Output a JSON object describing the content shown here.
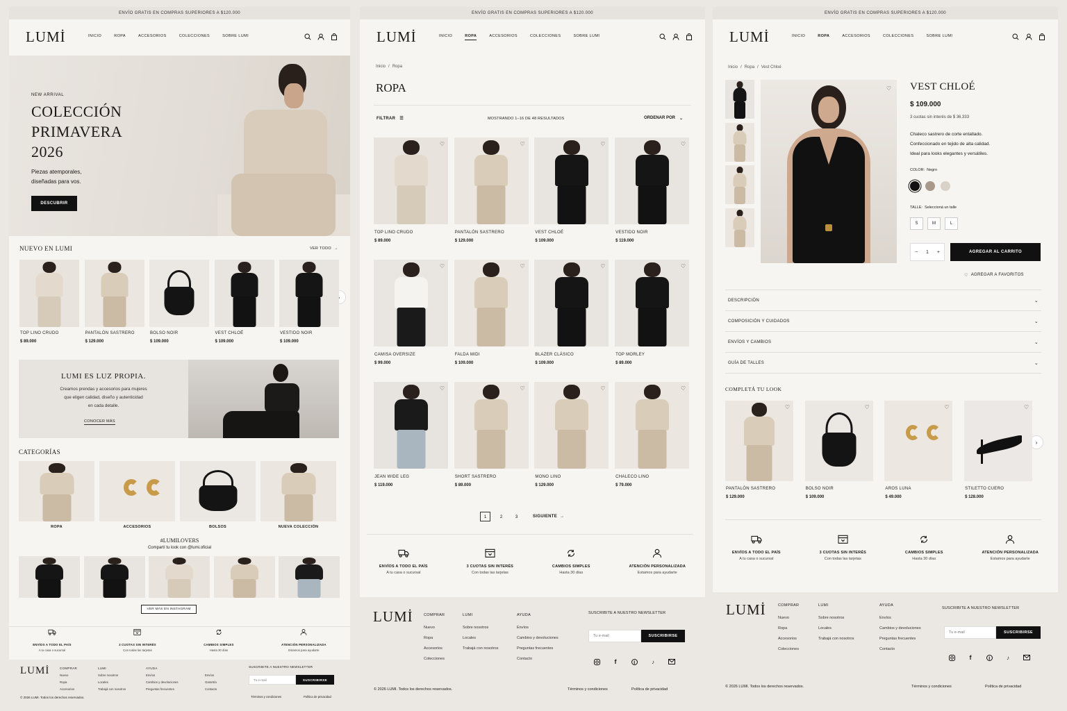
{
  "promo": "ENVÍO GRATIS EN COMPRAS SUPERIORES A $120.000",
  "brand": "LUMİ",
  "nav": [
    "INICIO",
    "ROPA",
    "ACCESORIOS",
    "COLECCIONES",
    "SOBRE LUMI"
  ],
  "home": {
    "hero": {
      "eyebrow": "NEW ARRIVAL",
      "title1": "COLECCIÓN",
      "title2": "PRIMAVERA",
      "title3": "2026",
      "sub1": "Piezas atemporales,",
      "sub2": "diseñadas para vos.",
      "cta": "DESCUBRIR"
    },
    "new_title": "NUEVO EN LUMI",
    "see_all": "VER TODO",
    "new_items": [
      {
        "name": "TOP LINO CRUDO",
        "price": "$ 89.000"
      },
      {
        "name": "PANTALÓN SASTRERO",
        "price": "$ 129.000"
      },
      {
        "name": "BOLSO NOIR",
        "price": "$ 109.000"
      },
      {
        "name": "VEST CHLOÉ",
        "price": "$ 109.000"
      },
      {
        "name": "VESTIDO NOIR",
        "price": "$ 109.000"
      }
    ],
    "banner": {
      "title": "LUMI ES LUZ PROPIA.",
      "l1": "Creamos prendas y accesorios para mujeres",
      "l2": "que eligen calidad, diseño y autenticidad",
      "l3": "en cada detalle.",
      "link": "CONOCER MÁS"
    },
    "cat_title": "CATEGORÍAS",
    "categories": [
      "ROPA",
      "ACCESORIOS",
      "BOLSOS",
      "NUEVA COLECCIÓN"
    ],
    "insta_tag": "#LUMILOVERS",
    "insta_sub": "Compartí tu look con @lumi.oficial",
    "insta_btn": "VER MÁS EN INSTAGRAM",
    "footer_extra": [
      "Envíos",
      "Garantía",
      "Contacto"
    ]
  },
  "benefits": [
    {
      "t": "ENVÍOS A TODO EL PAÍS",
      "s": "A tu casa o sucursal"
    },
    {
      "t": "3 CUOTAS SIN INTERÉS",
      "s": "Con todas las tarjetas"
    },
    {
      "t": "CAMBIOS SIMPLES",
      "s": "Hasta 30 días"
    },
    {
      "t": "ATENCIÓN PERSONALIZADA",
      "s": "Estamos para ayudarte"
    }
  ],
  "footer": {
    "cols": [
      {
        "h": "COMPRAR",
        "items": [
          "Nuevo",
          "Ropa",
          "Accesorios",
          "Colecciones"
        ]
      },
      {
        "h": "LUMI",
        "items": [
          "Sobre nosotros",
          "Locales",
          "Trabajá con nosotros"
        ]
      },
      {
        "h": "AYUDA",
        "items": [
          "Envíos",
          "Cambios y devoluciones",
          "Preguntas frecuentes",
          "Contacto"
        ]
      }
    ],
    "news_title": "SUSCRIBITE A NUESTRO NEWSLETTER",
    "email_ph": "Tu e-mail",
    "subscribe": "SUSCRIBIRSE",
    "copyright": "© 2026 LUMI. Todos los derechos reservados.",
    "terms": "Términos y condiciones",
    "privacy": "Política de privacidad"
  },
  "listing": {
    "crumb_home": "Inicio",
    "crumb_sep": "/",
    "crumb_cur": "Ropa",
    "title": "ROPA",
    "filter": "FILTRAR",
    "results": "MOSTRANDO 1–16 DE 48 RESULTADOS",
    "sort": "ORDENAR POR",
    "products": [
      {
        "name": "TOP LINO CRUDO",
        "price": "$ 89.000"
      },
      {
        "name": "PANTALÓN SASTRERO",
        "price": "$ 129.000"
      },
      {
        "name": "VEST CHLOÉ",
        "price": "$ 109.000"
      },
      {
        "name": "VESTIDO NOIR",
        "price": "$ 119.000"
      },
      {
        "name": "CAMISA OVERSIZE",
        "price": "$ 99.000"
      },
      {
        "name": "FALDA MIDI",
        "price": "$ 109.000"
      },
      {
        "name": "BLAZER CLÁSICO",
        "price": "$ 109.000"
      },
      {
        "name": "TOP MORLEY",
        "price": "$ 89.000"
      },
      {
        "name": "JEAN WIDE LEG",
        "price": "$ 119.000"
      },
      {
        "name": "SHORT SASTRERO",
        "price": "$ 89.000"
      },
      {
        "name": "MONO LINO",
        "price": "$ 129.000"
      },
      {
        "name": "CHALECO LINO",
        "price": "$ 79.000"
      }
    ],
    "pages": [
      "1",
      "2",
      "3"
    ],
    "next": "SIGUIENTE"
  },
  "pdp": {
    "crumb_home": "Inicio",
    "crumb_cat": "Ropa",
    "crumb_cur": "Vest Chloé",
    "name": "VEST CHLOÉ",
    "price": "$ 109.000",
    "installments": "3 cuotas sin interés de $ 36.333",
    "d1": "Chaleco sastrero de corte entallado.",
    "d2": "Confeccionado en tejido de alta calidad.",
    "d3": "Ideal para looks elegantes y versátiles.",
    "color_label": "COLOR:",
    "color_value": "Negro",
    "swatches": [
      "#111111",
      "#a8998a",
      "#d9d2c8"
    ],
    "size_label": "TALLE:",
    "size_value": "Seleccioná un talle",
    "sizes": [
      "S",
      "M",
      "L"
    ],
    "qty": "1",
    "add": "AGREGAR AL CARRITO",
    "fav": "AGREGAR A FAVORITOS",
    "accordion": [
      "DESCRIPCIÓN",
      "COMPOSICIÓN Y CUIDADOS",
      "ENVÍOS Y CAMBIOS",
      "GUÍA DE TALLES"
    ],
    "look_title": "COMPLETÁ TU LOOK",
    "look": [
      {
        "name": "PANTALÓN SASTRERO",
        "price": "$ 129.000"
      },
      {
        "name": "BOLSO NOIR",
        "price": "$ 109.000"
      },
      {
        "name": "AROS LUNA",
        "price": "$ 49.000"
      },
      {
        "name": "STILETTO CUERO",
        "price": "$ 128.000"
      }
    ]
  }
}
